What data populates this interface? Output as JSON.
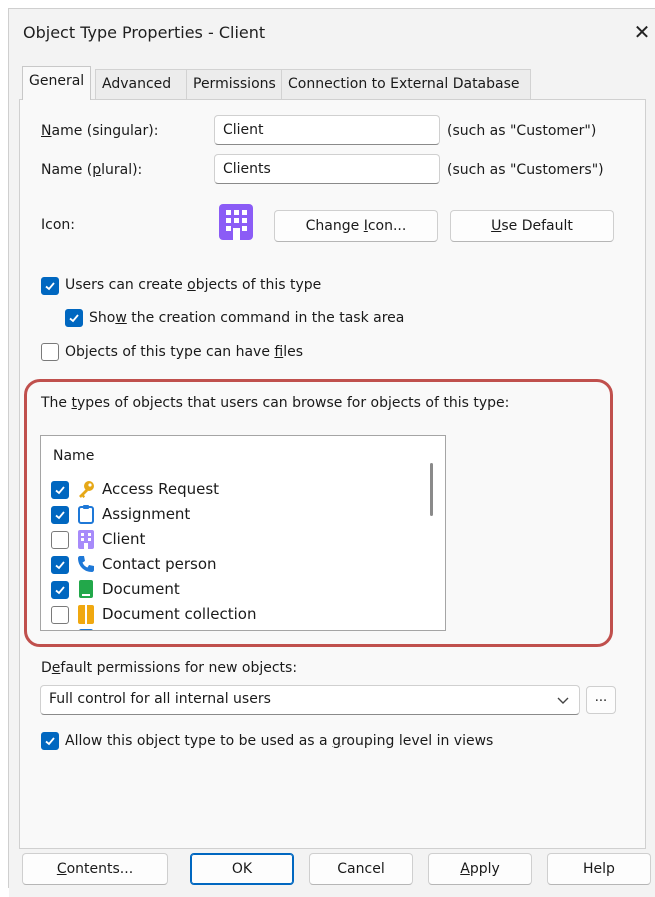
{
  "window": {
    "title": "Object Type Properties - Client",
    "close_glyph": "✕"
  },
  "tabs": [
    {
      "label": "General",
      "active": true
    },
    {
      "label": "Advanced",
      "active": false
    },
    {
      "label": "Permissions",
      "active": false
    },
    {
      "label": "Connection to External Database",
      "active": false
    }
  ],
  "general": {
    "name_singular": {
      "label_pre": "",
      "label_u": "N",
      "label_post": "ame (singular):",
      "value": "Client",
      "hint": "(such as \"Customer\")"
    },
    "name_plural": {
      "label_pre": "Name (",
      "label_u": "p",
      "label_post": "lural):",
      "value": "Clients",
      "hint": "(such as \"Customers\")"
    },
    "icon": {
      "label": "Icon:",
      "icon_name": "client-building-icon",
      "color": "#8b5cf6",
      "change_pre": "Change ",
      "change_u": "I",
      "change_post": "con...",
      "default_pre": "",
      "default_u": "U",
      "default_post": "se Default"
    },
    "users_can_create": {
      "checked": true,
      "pre": "Users can create ",
      "u": "o",
      "post": "bjects of this type"
    },
    "show_creation": {
      "checked": true,
      "pre": "Sho",
      "u": "w",
      "post": " the creation command in the task area"
    },
    "can_have_files": {
      "checked": false,
      "pre": "Objects of this type can have ",
      "u": "f",
      "post": "iles"
    }
  },
  "browse": {
    "label_pre": "The ",
    "label_u": "t",
    "label_post": "ypes of objects that users can browse for objects of this type:",
    "column_header": "Name",
    "items": [
      {
        "label": "Access Request",
        "checked": true,
        "icon": "key-icon",
        "color": "#e6a817"
      },
      {
        "label": "Assignment",
        "checked": true,
        "icon": "clipboard-icon",
        "color": "#1e78d7"
      },
      {
        "label": "Client",
        "checked": false,
        "icon": "client-building-icon",
        "color": "#8b5cf6"
      },
      {
        "label": "Contact person",
        "checked": true,
        "icon": "phone-icon",
        "color": "#1e78d7"
      },
      {
        "label": "Document",
        "checked": true,
        "icon": "document-icon",
        "color": "#22a84a"
      },
      {
        "label": "Document collection",
        "checked": false,
        "icon": "document-collection-icon",
        "color": "#f0a810"
      }
    ]
  },
  "permissions": {
    "label_pre": "D",
    "label_u": "e",
    "label_post": "fault permissions for new objects:",
    "selected": "Full control for all internal users",
    "ellipsis": "..."
  },
  "grouping": {
    "checked": true,
    "pre": "Allow this object type to be used as a ",
    "u": "g",
    "post": "rouping level in views"
  },
  "footer": {
    "contents": {
      "pre": "",
      "u": "C",
      "post": "ontents..."
    },
    "ok": "OK",
    "cancel": "Cancel",
    "apply": {
      "pre": "",
      "u": "A",
      "post": "pply"
    },
    "help": "Help"
  },
  "colors": {
    "accent": "#0067c0",
    "highlight_border": "#c0504d"
  }
}
